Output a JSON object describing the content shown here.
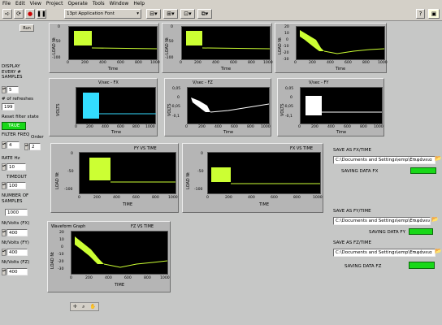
{
  "menu": [
    "File",
    "Edit",
    "View",
    "Project",
    "Operate",
    "Tools",
    "Window",
    "Help"
  ],
  "toolbar": {
    "font": "13pt Application Font"
  },
  "run_button": "Run",
  "controls": {
    "display_label": "DISPLAY\nEVERY #\nSAMPLES",
    "display_value": "5",
    "refreshes_label": "# of refreshes",
    "refreshes_value": "199",
    "reset_label": "Reset filter state",
    "reset_value": "TRUE",
    "filter_label": "FILTER FREQ",
    "filter_value": "4",
    "order_label": "Order",
    "order_value": "2",
    "rate_label": "RATE Hz",
    "rate_value": "10",
    "timeout_label": "TIMEOUT",
    "timeout_value": "100",
    "samples_label": "NUMBER OF\nSAMPLES",
    "samples_value": "1000",
    "fx_label": "Nt/Volts (FX)",
    "fx_value": "400",
    "fy_label": "Nt/Volts (FY)",
    "fy_value": "400",
    "fz_label": "Nt/Volts (FZ)",
    "fz_value": "400"
  },
  "graphs": {
    "top1": {
      "ylabel": "LOAD Nt",
      "xlabel": "Time",
      "yticks": [
        "0",
        "-50",
        "-100"
      ],
      "xticks": [
        "0",
        "200",
        "400",
        "600",
        "800",
        "1000"
      ]
    },
    "top2": {
      "ylabel": "LOAD Nt",
      "xlabel": "Time",
      "yticks": [
        "0",
        "-50",
        "-100"
      ],
      "xticks": [
        "0",
        "200",
        "400",
        "600",
        "800",
        "1000"
      ]
    },
    "top3": {
      "ylabel": "LOAD Nt",
      "xlabel": "Time",
      "yticks": [
        "20",
        "10",
        "0",
        "-10",
        "-20",
        "-30"
      ],
      "xticks": [
        "0",
        "200",
        "400",
        "600",
        "800",
        "1000"
      ]
    },
    "vfx": {
      "title": "V/sec - FX",
      "ylabel": "VOLTS",
      "xlabel": "Time",
      "yticks": [
        "0,05",
        "0",
        "-0,05",
        "-0,1"
      ],
      "xticks": [
        "0",
        "200",
        "400",
        "600",
        "800",
        "1000"
      ]
    },
    "vfz": {
      "title": "V/sec - FZ",
      "ylabel": "VOLTS",
      "xlabel": "Time",
      "yticks": [
        "0,05",
        "0",
        "-0,05",
        "-0,1"
      ],
      "xticks": [
        "0",
        "200",
        "400",
        "600",
        "800",
        "1000"
      ]
    },
    "vfy": {
      "title": "V/sec - FY",
      "ylabel": "VOLTS",
      "xlabel": "Time",
      "yticks": [
        "0,05",
        "0",
        "-0,05",
        "-0,1"
      ],
      "xticks": [
        "0",
        "200",
        "400",
        "600",
        "800",
        "1000"
      ]
    },
    "fy": {
      "title": "FY VS TIME",
      "ylabel": "LOAD Nt",
      "xlabel": "TIME",
      "yticks": [
        "0",
        "-50",
        "-100"
      ],
      "xticks": [
        "0",
        "200",
        "400",
        "600",
        "800",
        "1000"
      ]
    },
    "fx": {
      "title": "FX VS TIME",
      "ylabel": "LOAD Nt",
      "xlabel": "TIME",
      "yticks": [
        "0",
        "-50",
        "-100"
      ],
      "xticks": [
        "0",
        "200",
        "400",
        "600",
        "800",
        "1000"
      ]
    },
    "fz": {
      "caption": "Waveform Graph",
      "title": "FZ VS TIME",
      "ylabel": "LOAD Nt",
      "xlabel": "TIME",
      "yticks": [
        "20",
        "10",
        "0",
        "-10",
        "-20",
        "-30"
      ],
      "xticks": [
        "0",
        "200",
        "400",
        "600",
        "800",
        "1000"
      ]
    }
  },
  "save": {
    "fx_label": "SAVE AS FX/TIME",
    "fx_path": "C:\\Documents and Settings\\emp\\Επιφάνεια",
    "fx_status": "SAVING DATA FX",
    "fy_label": "SAVE AS FY/TIME",
    "fy_path": "C:\\Documents and Settings\\emp\\Επιφάνεια",
    "fy_status": "SAVING DATA FY",
    "fz_label": "SAVE AS FZ/TIME",
    "fz_path": "C:\\Documents and Settings\\emp\\Επιφάνεια",
    "fz_status": "SAVING DATA FZ"
  },
  "colors": {
    "trace": "#ccff33",
    "cyan": "#33ddff",
    "white": "#ffffff",
    "led": "#18d818",
    "bg": "#c6c7c6"
  }
}
